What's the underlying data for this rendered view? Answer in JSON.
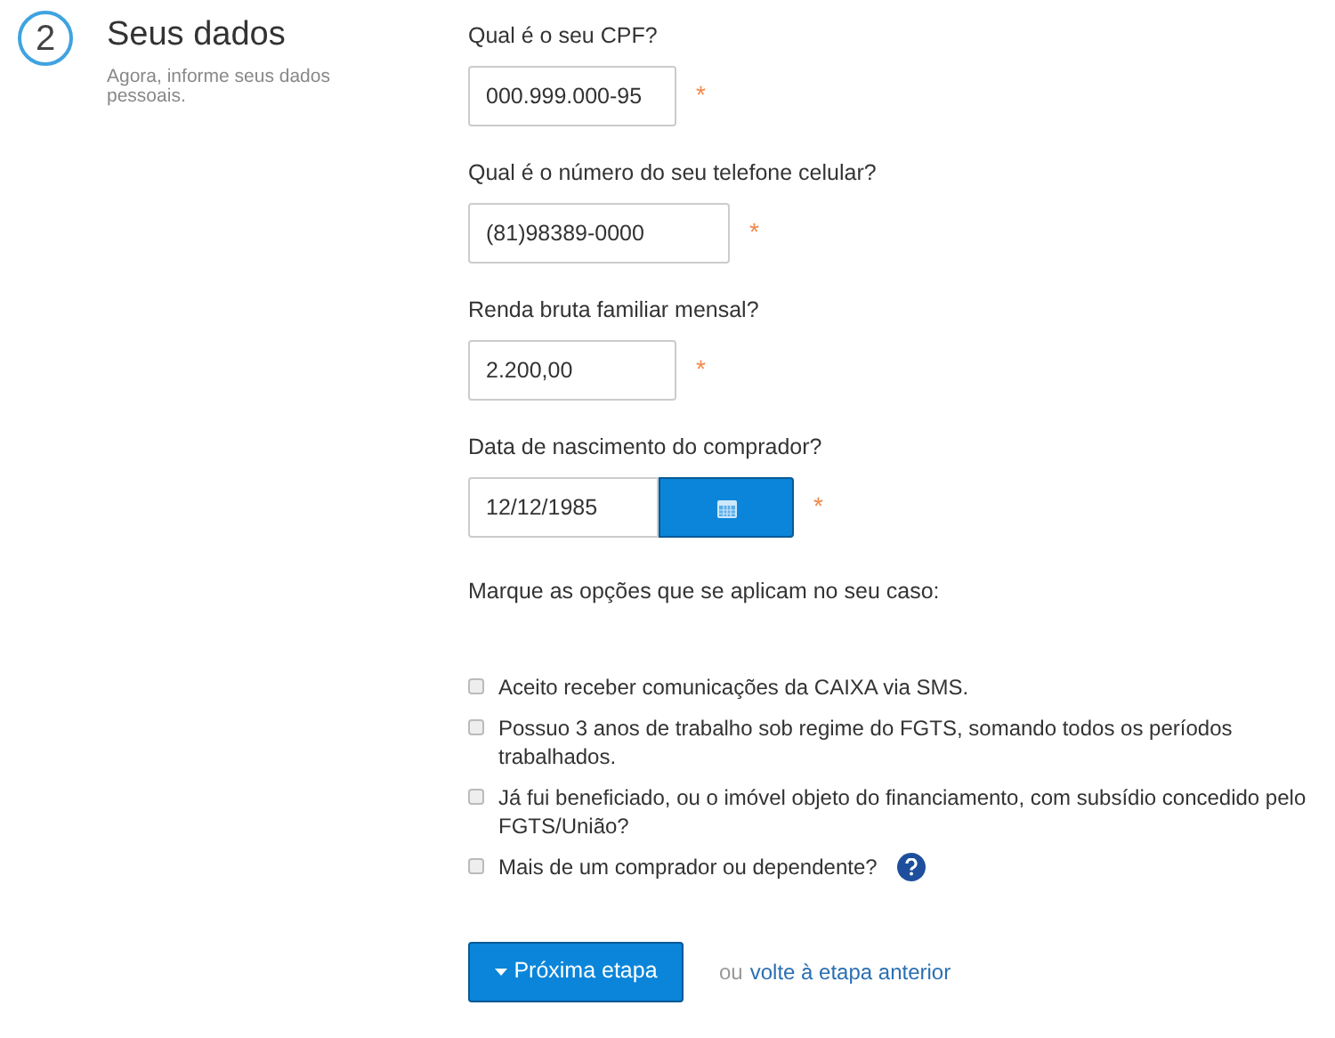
{
  "step": {
    "number": "2",
    "title": "Seus dados",
    "description": "Agora, informe seus dados pessoais."
  },
  "fields": [
    {
      "kind": "text",
      "label": "Qual é o seu CPF?",
      "value": "000.999.000-95",
      "required_mark": "*",
      "wide": false
    },
    {
      "kind": "text",
      "label": "Qual é o número do seu telefone celular?",
      "value": "(81)98389-0000",
      "required_mark": "*",
      "wide": true
    },
    {
      "kind": "text",
      "label": "Renda bruta familiar mensal?",
      "value": "2.200,00",
      "required_mark": "*",
      "wide": false
    },
    {
      "kind": "date",
      "label": "Data de nascimento do comprador?",
      "value": "12/12/1985",
      "required_mark": "*"
    }
  ],
  "options_prompt": "Marque as opções que se aplicam no seu caso:",
  "options": [
    {
      "label": "Aceito receber comunicações da CAIXA via SMS.",
      "checked": false,
      "help": false
    },
    {
      "label": "Possuo 3 anos de trabalho sob regime do FGTS, somando todos os períodos trabalhados.",
      "checked": false,
      "help": false
    },
    {
      "label": "Já fui beneficiado, ou o imóvel objeto do financiamento, com subsídio concedido pelo FGTS/União?",
      "checked": false,
      "help": false
    },
    {
      "label": "Mais de um comprador ou dependente?",
      "checked": false,
      "help": true
    }
  ],
  "next_button": "Próxima etapa",
  "back": {
    "prefix": "ou",
    "link": "volte à etapa anterior"
  }
}
